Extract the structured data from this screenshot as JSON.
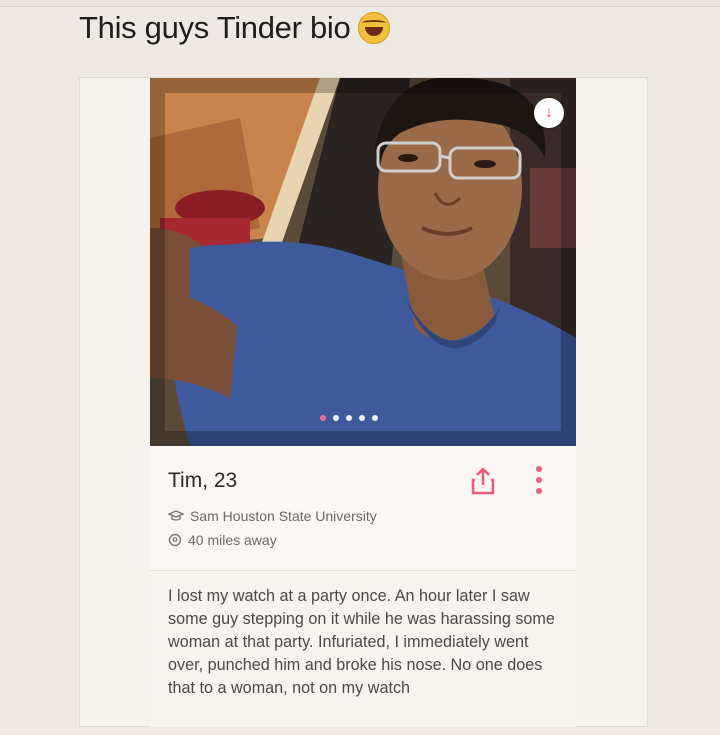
{
  "caption": {
    "text": "This guys Tinder bio",
    "emoji": "face-with-tears-of-joy"
  },
  "photo": {
    "page_count": 5,
    "active_index": 0,
    "action_icon": "arrow-down-icon"
  },
  "profile": {
    "name_age": "Tim, 23",
    "school": "Sam Houston State University",
    "distance": "40 miles away"
  },
  "bio_text": "I lost my watch at a party once. An hour later I saw some guy stepping on it while he was harassing some woman at that party. Infuriated, I immediately went over, punched him and broke his nose. No one does that to a woman, not on my watch",
  "colors": {
    "accent": "#f05a7a",
    "background": "#efe9e3",
    "shirt": "#3e5a9c"
  }
}
